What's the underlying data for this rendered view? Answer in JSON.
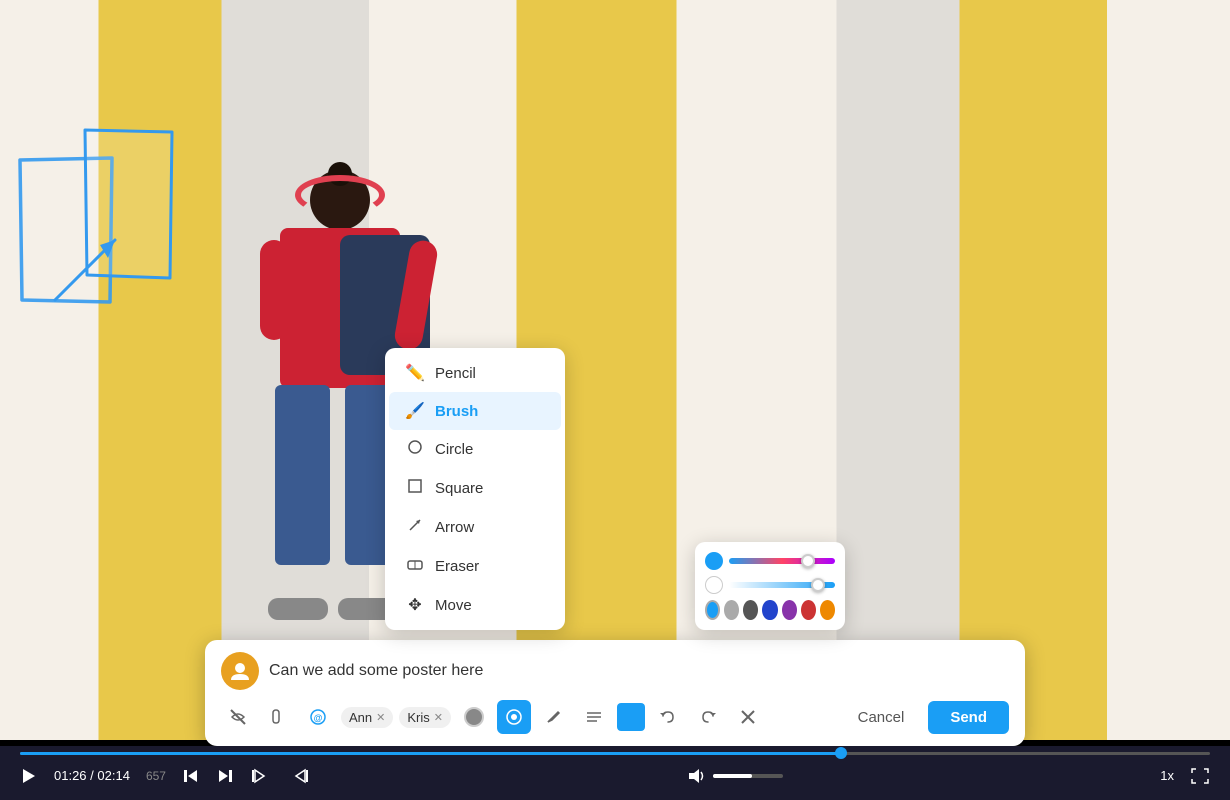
{
  "video": {
    "background_desc": "Boy with backpack and headphones on striped wall",
    "time_current": "01:26",
    "time_total": "02:14",
    "frame": "657",
    "speed": "1x"
  },
  "comment": {
    "avatar_initials": "",
    "avatar_color": "#e8a020",
    "text": "Can we add some poster here",
    "placeholder": "Can we add some poster here"
  },
  "toolbar": {
    "mention_label": "@",
    "tag1": "Ann",
    "tag2": "Kris",
    "cancel_label": "Cancel",
    "send_label": "Send"
  },
  "drawing_menu": {
    "items": [
      {
        "id": "pencil",
        "label": "Pencil",
        "icon": "✏️"
      },
      {
        "id": "brush",
        "label": "Brush",
        "icon": "🖌️",
        "selected": true
      },
      {
        "id": "circle",
        "label": "Circle",
        "icon": "○"
      },
      {
        "id": "square",
        "label": "Square",
        "icon": "□"
      },
      {
        "id": "arrow",
        "label": "Arrow",
        "icon": "↗"
      },
      {
        "id": "eraser",
        "label": "Eraser",
        "icon": "⬜"
      },
      {
        "id": "move",
        "label": "Move",
        "icon": "✥"
      }
    ]
  },
  "colors": {
    "selected": "#1a9ef5",
    "swatches": [
      "#1a9ef5",
      "#aaaaaa",
      "#555555",
      "#2244cc",
      "#8833aa",
      "#cc3333",
      "#ee8800"
    ]
  },
  "controls": {
    "play_icon": "▶",
    "prev_icon": "⏮",
    "next_icon": "⏭",
    "volume_icon": "🔊",
    "fullscreen_icon": "⛶"
  }
}
